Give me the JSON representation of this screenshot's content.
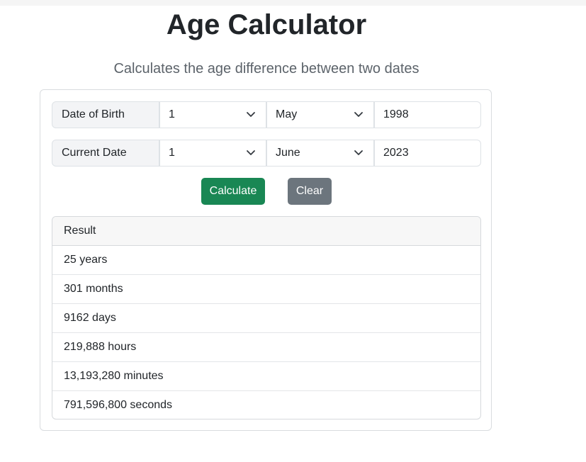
{
  "page": {
    "title": "Age Calculator",
    "subtitle": "Calculates the age difference between two dates"
  },
  "form": {
    "dob": {
      "label": "Date of Birth",
      "day": "1",
      "month": "May",
      "year": "1998"
    },
    "current": {
      "label": "Current Date",
      "day": "1",
      "month": "June",
      "year": "2023"
    }
  },
  "buttons": {
    "calculate": "Calculate",
    "clear": "Clear"
  },
  "result": {
    "header": "Result",
    "items": [
      "25 years",
      "301 months",
      "9162 days",
      "219,888 hours",
      "13,193,280 minutes",
      "791,596,800 seconds"
    ]
  },
  "colors": {
    "calculate": "#198754",
    "clear": "#6c757d"
  },
  "icons": {
    "select_indicator": "chevron-down-icon"
  }
}
